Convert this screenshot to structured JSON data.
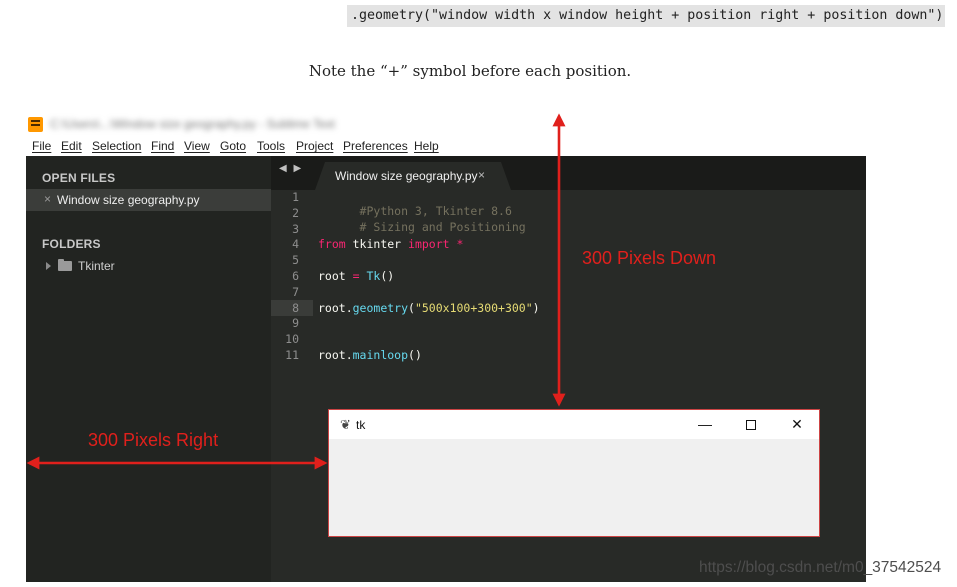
{
  "code_snippet": ".geometry(\"window width x window height + position right + position down\")",
  "note": "Note the “+” symbol before each position.",
  "editor": {
    "title": "C:\\Users\\...\\Window size geography.py - Sublime Text",
    "menu": [
      "File",
      "Edit",
      "Selection",
      "Find",
      "View",
      "Goto",
      "Tools",
      "Project",
      "Preferences",
      "Help"
    ],
    "sidebar": {
      "open_files_header": "OPEN FILES",
      "open_file": "Window size geography.py",
      "close_glyph": "×",
      "folders_header": "FOLDERS",
      "folder": "Tkinter"
    },
    "nav_arrows": "◀ ▶",
    "tab": {
      "label": "Window size geography.py",
      "close_glyph": "×"
    },
    "line_numbers": [
      "1",
      "2",
      "3",
      "4",
      "5",
      "6",
      "7",
      "8",
      "9",
      "10",
      "11"
    ],
    "code": {
      "l1": "#Python 3, Tkinter 8.6",
      "l2": "# Sizing and Positioning",
      "l4_kw1": "from",
      "l4_mod": " tkinter ",
      "l4_kw2": "import",
      "l4_star": " *",
      "l6_var": "root ",
      "l6_eq": "=",
      "l6_sp": " ",
      "l6_func": "Tk",
      "l6_paren": "()",
      "l8_obj": "root.",
      "l8_method": "geometry",
      "l8_open": "(",
      "l8_str": "\"500x100+300+300\"",
      "l8_close": ")",
      "l11_obj": "root.",
      "l11_method": "mainloop",
      "l11_paren": "()"
    }
  },
  "tk_window": {
    "title": "tk",
    "feather_icon": "❦",
    "minimize_glyph": "—",
    "close_glyph": "✕"
  },
  "annotations": {
    "down_label": "300 Pixels Down",
    "right_label": "300 Pixels Right",
    "arrow_color": "#e0201c"
  },
  "watermark": "https://blog.csdn.net/m0_37542524"
}
